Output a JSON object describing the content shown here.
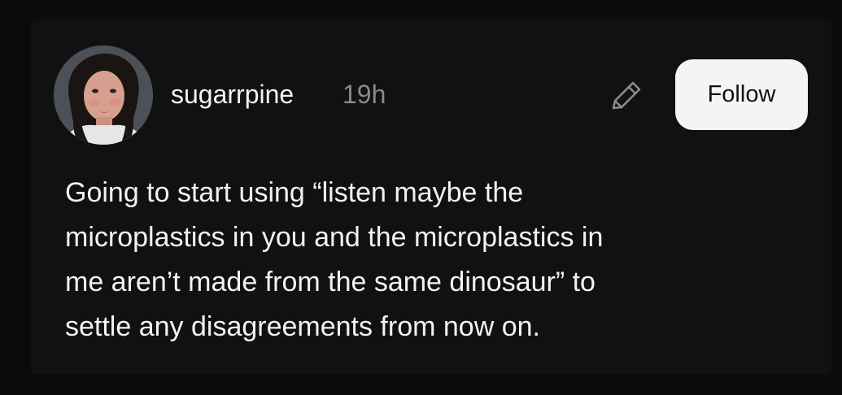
{
  "post": {
    "username": "sugarrpine",
    "timestamp": "19h",
    "follow_label": "Follow",
    "text_lines": [
      "Going to start using “listen maybe the",
      "microplastics in you and the microplastics in",
      "me aren’t made from the same dinosaur” to",
      "settle any disagreements from now on."
    ]
  },
  "icons": {
    "edit": "pencil-icon",
    "avatar": "profile-photo"
  },
  "colors": {
    "background": "#0b0b0b",
    "text": "#f2f2f2",
    "muted": "#8a8a8a",
    "button_bg": "#f4f4f4"
  }
}
